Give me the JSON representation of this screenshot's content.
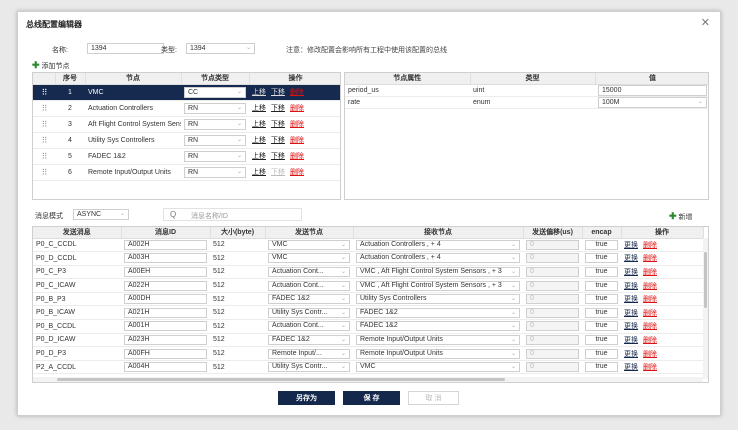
{
  "dialog": {
    "title": "总线配置编辑器",
    "close_glyph": "✕"
  },
  "form": {
    "name_label": "名称:",
    "name_value": "1394",
    "type_label": "类型:",
    "type_value": "1394",
    "notice": "注意：修改配置会影响所有工程中使用该配置的总线"
  },
  "add_node": {
    "plus": "✚",
    "label": "添加节点"
  },
  "nodes_table": {
    "headers": [
      "",
      "序号",
      "节点",
      "节点类型",
      "操作"
    ],
    "up": "上移",
    "down": "下移",
    "delete": "删除",
    "rows": [
      {
        "index": "1",
        "node": "VMC",
        "type": "CC"
      },
      {
        "index": "2",
        "node": "Actuation Controllers",
        "type": "RN"
      },
      {
        "index": "3",
        "node": "Aft Flight Control System Sensors",
        "type": "RN"
      },
      {
        "index": "4",
        "node": "Utility Sys Controllers",
        "type": "RN"
      },
      {
        "index": "5",
        "node": "FADEC 1&2",
        "type": "RN"
      },
      {
        "index": "6",
        "node": "Remote Input/Output Units",
        "type": "RN"
      }
    ]
  },
  "props_table": {
    "headers": [
      "节点属性",
      "类型",
      "值"
    ],
    "rows": [
      {
        "name": "period_us",
        "type": "uint",
        "value": "15000"
      },
      {
        "name": "rate",
        "type": "enum",
        "value": "100M"
      }
    ]
  },
  "message_mode": {
    "label": "消息模式",
    "value": "ASYNC"
  },
  "search": {
    "icon_glyph": "Q",
    "placeholder": "消息名称/ID"
  },
  "add_new": {
    "plus": "✚",
    "label": "新增"
  },
  "messages_table": {
    "headers": [
      "发送消息",
      "消息ID",
      "大小(byte)",
      "发送节点",
      "接收节点",
      "发送偏移(us)",
      "encap",
      "操作"
    ],
    "change": "更换",
    "delete": "删除",
    "rows": [
      {
        "msg": "P0_C_CCDL",
        "id": "A002H",
        "size": "512",
        "sender": "VMC",
        "receiver": "Actuation Controllers , + 4",
        "offset": "0",
        "encap": "true"
      },
      {
        "msg": "P0_D_CCDL",
        "id": "A003H",
        "size": "512",
        "sender": "VMC",
        "receiver": "Actuation Controllers , + 4",
        "offset": "0",
        "encap": "true"
      },
      {
        "msg": "P0_C_P3",
        "id": "A00EH",
        "size": "512",
        "sender": "Actuation Cont...",
        "receiver": "VMC , Aft Flight Control System Sensors , + 3",
        "offset": "0",
        "encap": "true"
      },
      {
        "msg": "P0_C_ICAW",
        "id": "A022H",
        "size": "512",
        "sender": "Actuation Cont...",
        "receiver": "VMC , Aft Flight Control System Sensors , + 3",
        "offset": "0",
        "encap": "true"
      },
      {
        "msg": "P0_B_P3",
        "id": "A00DH",
        "size": "512",
        "sender": "FADEC 1&2",
        "receiver": "Utility Sys Controllers",
        "offset": "0",
        "encap": "true"
      },
      {
        "msg": "P0_B_ICAW",
        "id": "A021H",
        "size": "512",
        "sender": "Utility Sys Contr...",
        "receiver": "FADEC 1&2",
        "offset": "0",
        "encap": "true"
      },
      {
        "msg": "P0_B_CCDL",
        "id": "A001H",
        "size": "512",
        "sender": "Actuation Cont...",
        "receiver": "FADEC 1&2",
        "offset": "0",
        "encap": "true"
      },
      {
        "msg": "P0_D_ICAW",
        "id": "A023H",
        "size": "512",
        "sender": "FADEC 1&2",
        "receiver": "Remote Input/Output Units",
        "offset": "0",
        "encap": "true"
      },
      {
        "msg": "P0_D_P3",
        "id": "A00FH",
        "size": "512",
        "sender": "Remote Input/...",
        "receiver": "Remote Input/Output Units",
        "offset": "0",
        "encap": "true"
      },
      {
        "msg": "P2_A_CCDL",
        "id": "A004H",
        "size": "512",
        "sender": "Utility Sys Contr...",
        "receiver": "VMC",
        "offset": "0",
        "encap": "true"
      }
    ]
  },
  "buttons": {
    "save_as": "另存为",
    "save": "保 存",
    "cancel": "取 消"
  }
}
